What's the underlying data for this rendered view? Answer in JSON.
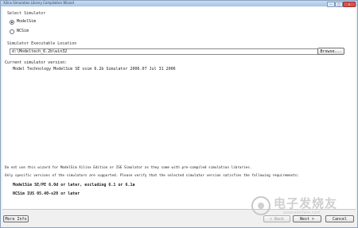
{
  "window": {
    "title": "Xilinx Simulation Library Compilation Wizard"
  },
  "simulator_section": {
    "heading": "Select Simulator",
    "options": [
      {
        "label": "ModelSim",
        "selected": true
      },
      {
        "label": "NCSim",
        "selected": false
      }
    ]
  },
  "location_section": {
    "heading": "Simulator Executable Location",
    "path_value": "d:\\Modeltech_6.2b\\win32",
    "browse_label": "Browse..."
  },
  "version_section": {
    "heading": "Current simulator version:",
    "value": "Model Technology ModelSim SE vsim 6.2b Simulator 2006.07 Jul 31 2006"
  },
  "notes": {
    "line1": "Do not use this wizard for ModelSim Xilinx Edition or ISE Simulator as they come with pre-compiled simulation libraries.",
    "line2": "Only specific versions of the simulators are supported. Please verify that the selected simulator version satisfies the following requirements:",
    "req1": "ModelSim SE/PE 6.0d or later, excluding 6.1 or 6.1a",
    "req2": "NCSim IUS 05.40-s20 or later"
  },
  "footer": {
    "more_info_label": "More Info",
    "back_label": "< Back",
    "next_label": "Next >",
    "cancel_label": "Cancel"
  },
  "watermark": {
    "text": "电子发烧友",
    "sub": "www.elecfans.com"
  }
}
